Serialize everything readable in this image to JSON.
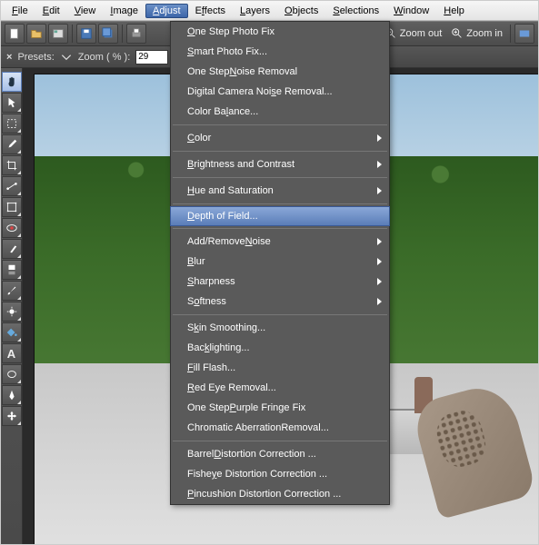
{
  "menubar": {
    "items": [
      {
        "label": "File",
        "u": 0
      },
      {
        "label": "Edit",
        "u": 0
      },
      {
        "label": "View",
        "u": 0
      },
      {
        "label": "Image",
        "u": 0
      },
      {
        "label": "Adjust",
        "u": 0,
        "active": true
      },
      {
        "label": "Effects",
        "u": 1
      },
      {
        "label": "Layers",
        "u": 0
      },
      {
        "label": "Objects",
        "u": 0
      },
      {
        "label": "Selections",
        "u": 0
      },
      {
        "label": "Window",
        "u": 0
      },
      {
        "label": "Help",
        "u": 0
      }
    ]
  },
  "toolbar_right": {
    "zoom_out": "Zoom out",
    "zoom_in": "Zoom in"
  },
  "optbar": {
    "presets": "Presets:",
    "zoom_label": "Zoom ( % ):",
    "zoom_value": "29"
  },
  "dropdown": {
    "groups": [
      [
        {
          "label": "One Step Photo Fix",
          "u": 0
        },
        {
          "label": "Smart Photo Fix...",
          "u": 0
        },
        {
          "label": "One Step Noise Removal",
          "u": 9
        },
        {
          "label": "Digital Camera Noise Removal...",
          "u": 18
        },
        {
          "label": "Color Balance...",
          "u": 8
        }
      ],
      [
        {
          "label": "Color",
          "u": 0,
          "sub": true
        }
      ],
      [
        {
          "label": "Brightness and Contrast",
          "u": 0,
          "sub": true
        }
      ],
      [
        {
          "label": "Hue and Saturation",
          "u": 0,
          "sub": true
        }
      ],
      [
        {
          "label": "Depth of Field...",
          "u": 0,
          "hl": true
        }
      ],
      [
        {
          "label": "Add/Remove Noise",
          "u": 11,
          "sub": true
        },
        {
          "label": "Blur",
          "u": 0,
          "sub": true
        },
        {
          "label": "Sharpness",
          "u": 0,
          "sub": true
        },
        {
          "label": "Softness",
          "u": 1,
          "sub": true
        }
      ],
      [
        {
          "label": "Skin Smoothing...",
          "u": 1
        },
        {
          "label": "Backlighting...",
          "u": 3
        },
        {
          "label": "Fill Flash...",
          "u": 0
        },
        {
          "label": "Red Eye Removal...",
          "u": 0
        },
        {
          "label": "One Step Purple Fringe Fix",
          "u": 9
        },
        {
          "label": "Chromatic Aberration Removal...",
          "u": 20
        }
      ],
      [
        {
          "label": "Barrel Distortion Correction ...",
          "u": 7
        },
        {
          "label": "Fisheye Distortion Correction ...",
          "u": 5
        },
        {
          "label": "Pincushion Distortion Correction ...",
          "u": 0
        }
      ]
    ]
  }
}
